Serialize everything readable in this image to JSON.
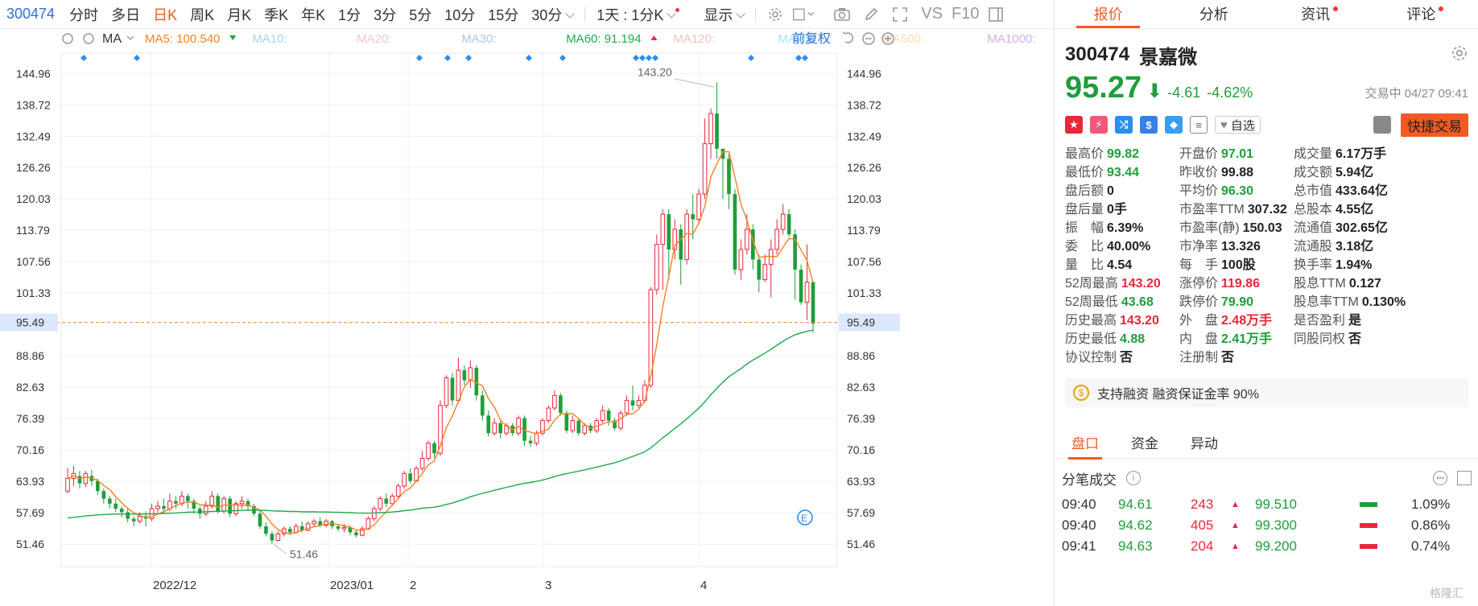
{
  "toolbar": {
    "code": "300474",
    "periods": [
      "分时",
      "多日",
      "日K",
      "周K",
      "月K",
      "季K",
      "年K",
      "1分",
      "3分",
      "5分",
      "10分",
      "15分"
    ],
    "active_period": "日K",
    "period_select": "30分",
    "day_select": "1天 : 1分K",
    "display_select": "显示",
    "vs_label": "VS",
    "f10_label": "F10"
  },
  "indicators": {
    "type_select": "MA",
    "items": [
      {
        "label": "MA5:",
        "value": "100.540",
        "color": "#f58220",
        "arrow": "down"
      },
      {
        "label": "MA10:",
        "value": "",
        "color": "#a8d4f0",
        "arrow": ""
      },
      {
        "label": "MA20:",
        "value": "",
        "color": "#f5c2d8",
        "arrow": ""
      },
      {
        "label": "MA30:",
        "value": "",
        "color": "#a8c8f0",
        "arrow": ""
      },
      {
        "label": "MA60:",
        "value": "91.194",
        "color": "#1aab4c",
        "arrow": "up"
      },
      {
        "label": "MA120:",
        "value": "",
        "color": "#f5c2c2",
        "arrow": ""
      },
      {
        "label": "MA250:",
        "value": "",
        "color": "#a8e4f5",
        "arrow": ""
      },
      {
        "label": "MA500:",
        "value": "",
        "color": "#f5deb0",
        "arrow": ""
      },
      {
        "label": "MA1000:",
        "value": "",
        "color": "#d0b0e8",
        "arrow": ""
      }
    ],
    "adjust_label": "前复权"
  },
  "chart_data": {
    "type": "candlestick",
    "y_ticks": [
      "144.96",
      "138.72",
      "132.49",
      "126.26",
      "120.03",
      "113.79",
      "107.56",
      "101.33",
      "95.49",
      "88.86",
      "82.63",
      "76.39",
      "70.16",
      "63.93",
      "57.69",
      "51.46"
    ],
    "ylim": [
      47.0,
      149.0
    ],
    "x_labels": [
      "2022/12",
      "2023/01",
      "2",
      "3",
      "4"
    ],
    "current_price_label": "95.49",
    "high_annotation": "143.20",
    "low_annotation": "51.46",
    "candles": [
      [
        62.0,
        64.5,
        61.5,
        66.5
      ],
      [
        64.5,
        65.5,
        63.0,
        67.0
      ],
      [
        65.0,
        63.5,
        62.5,
        66.0
      ],
      [
        63.5,
        65.5,
        62.8,
        66.0
      ],
      [
        65.0,
        64.0,
        63.0,
        66.2
      ],
      [
        64.0,
        62.0,
        61.2,
        64.5
      ],
      [
        62.0,
        60.5,
        59.5,
        62.5
      ],
      [
        60.5,
        59.5,
        58.5,
        61.0
      ],
      [
        59.5,
        58.5,
        57.8,
        60.5
      ],
      [
        58.5,
        57.8,
        56.8,
        59.0
      ],
      [
        57.8,
        56.5,
        55.8,
        58.5
      ],
      [
        56.5,
        56.0,
        55.0,
        57.0
      ],
      [
        56.0,
        57.0,
        55.5,
        57.8
      ],
      [
        57.0,
        56.5,
        55.0,
        58.0
      ],
      [
        56.5,
        58.5,
        56.0,
        59.5
      ],
      [
        58.5,
        59.0,
        57.8,
        60.0
      ],
      [
        59.0,
        58.5,
        57.5,
        60.5
      ],
      [
        58.5,
        60.0,
        58.0,
        61.5
      ],
      [
        60.0,
        59.5,
        58.5,
        61.0
      ],
      [
        59.5,
        61.0,
        59.0,
        62.0
      ],
      [
        61.0,
        60.0,
        58.5,
        61.5
      ],
      [
        60.0,
        58.5,
        57.5,
        60.5
      ],
      [
        58.5,
        57.5,
        56.5,
        59.0
      ],
      [
        57.5,
        59.0,
        57.0,
        60.0
      ],
      [
        59.0,
        61.0,
        58.5,
        62.0
      ],
      [
        61.0,
        58.0,
        57.5,
        61.5
      ],
      [
        58.0,
        60.5,
        57.5,
        61.0
      ],
      [
        60.5,
        57.5,
        56.8,
        61.0
      ],
      [
        57.5,
        59.5,
        57.0,
        60.0
      ],
      [
        59.5,
        60.0,
        58.5,
        61.0
      ],
      [
        60.0,
        59.0,
        58.0,
        60.5
      ],
      [
        59.0,
        57.5,
        57.0,
        59.5
      ],
      [
        57.5,
        55.0,
        54.5,
        58.0
      ],
      [
        55.0,
        53.5,
        53.0,
        55.8
      ],
      [
        53.5,
        52.2,
        51.46,
        54.0
      ],
      [
        52.2,
        53.5,
        52.0,
        54.0
      ],
      [
        53.5,
        54.5,
        53.0,
        55.0
      ],
      [
        54.5,
        53.8,
        53.2,
        55.0
      ],
      [
        53.8,
        55.0,
        53.5,
        55.5
      ],
      [
        55.0,
        54.2,
        53.8,
        56.0
      ],
      [
        54.2,
        55.5,
        54.0,
        56.0
      ],
      [
        55.5,
        56.0,
        55.0,
        56.5
      ],
      [
        56.0,
        55.2,
        54.8,
        56.8
      ],
      [
        55.2,
        56.0,
        54.8,
        56.5
      ],
      [
        56.0,
        55.0,
        54.5,
        56.3
      ],
      [
        55.0,
        54.5,
        54.0,
        55.5
      ],
      [
        54.5,
        54.8,
        53.8,
        55.5
      ],
      [
        54.8,
        53.8,
        53.2,
        55.2
      ],
      [
        53.8,
        53.2,
        52.8,
        54.2
      ],
      [
        53.2,
        54.5,
        53.0,
        55.0
      ],
      [
        54.5,
        56.5,
        54.3,
        57.0
      ],
      [
        56.5,
        58.5,
        56.0,
        59.0
      ],
      [
        58.5,
        60.5,
        58.0,
        61.0
      ],
      [
        60.5,
        59.5,
        58.8,
        61.5
      ],
      [
        59.5,
        61.0,
        59.0,
        61.5
      ],
      [
        61.0,
        63.0,
        60.5,
        63.5
      ],
      [
        63.0,
        65.5,
        62.5,
        66.0
      ],
      [
        65.5,
        64.0,
        63.5,
        66.5
      ],
      [
        64.0,
        66.5,
        63.8,
        67.0
      ],
      [
        66.5,
        68.5,
        66.0,
        70.0
      ],
      [
        68.5,
        71.5,
        68.0,
        72.0
      ],
      [
        71.5,
        69.5,
        68.5,
        72.0
      ],
      [
        69.5,
        79.0,
        69.0,
        80.0
      ],
      [
        79.0,
        84.5,
        78.5,
        85.0
      ],
      [
        84.5,
        80.0,
        79.0,
        85.5
      ],
      [
        80.0,
        86.0,
        79.5,
        88.5
      ],
      [
        86.0,
        84.0,
        83.0,
        87.0
      ],
      [
        84.0,
        86.5,
        82.5,
        88.0
      ],
      [
        86.5,
        81.0,
        80.0,
        87.0
      ],
      [
        81.0,
        77.0,
        76.0,
        82.0
      ],
      [
        77.0,
        73.5,
        72.8,
        78.0
      ],
      [
        73.5,
        75.5,
        73.0,
        76.5
      ],
      [
        75.5,
        73.5,
        72.5,
        76.0
      ],
      [
        73.5,
        75.0,
        73.0,
        75.5
      ],
      [
        75.0,
        73.5,
        73.0,
        75.5
      ],
      [
        73.5,
        76.5,
        73.0,
        77.0
      ],
      [
        76.5,
        72.0,
        71.0,
        77.0
      ],
      [
        72.0,
        71.5,
        70.8,
        73.0
      ],
      [
        71.5,
        73.5,
        71.0,
        74.0
      ],
      [
        73.5,
        76.0,
        73.0,
        76.5
      ],
      [
        76.0,
        78.5,
        75.5,
        79.0
      ],
      [
        78.5,
        81.0,
        78.0,
        82.0
      ],
      [
        81.0,
        77.5,
        77.0,
        81.5
      ],
      [
        77.5,
        74.0,
        73.5,
        78.0
      ],
      [
        74.0,
        76.0,
        73.5,
        77.0
      ],
      [
        76.0,
        73.5,
        73.0,
        76.5
      ],
      [
        73.5,
        75.0,
        73.0,
        75.5
      ],
      [
        75.0,
        74.0,
        73.5,
        75.5
      ],
      [
        74.0,
        76.0,
        73.5,
        76.5
      ],
      [
        76.0,
        78.0,
        75.5,
        79.0
      ],
      [
        78.0,
        76.0,
        75.0,
        78.5
      ],
      [
        76.0,
        74.5,
        74.0,
        76.5
      ],
      [
        74.5,
        77.5,
        74.0,
        78.0
      ],
      [
        77.5,
        80.0,
        77.0,
        81.0
      ],
      [
        80.0,
        79.0,
        78.0,
        83.0
      ],
      [
        79.0,
        80.0,
        78.5,
        81.0
      ],
      [
        80.0,
        83.0,
        79.5,
        84.0
      ],
      [
        83.0,
        102.0,
        82.5,
        102.5
      ],
      [
        102.0,
        111.0,
        101.0,
        113.0
      ],
      [
        111.0,
        117.0,
        102.0,
        118.0
      ],
      [
        117.0,
        110.0,
        104.0,
        118.0
      ],
      [
        110.0,
        114.0,
        108.0,
        116.0
      ],
      [
        114.0,
        108.0,
        103.0,
        115.0
      ],
      [
        108.0,
        117.0,
        107.0,
        118.0
      ],
      [
        117.0,
        116.0,
        112.0,
        121.0
      ],
      [
        116.0,
        121.0,
        115.0,
        122.0
      ],
      [
        121.0,
        131.0,
        120.0,
        136.0
      ],
      [
        131.0,
        137.0,
        128.0,
        138.0
      ],
      [
        137.0,
        130.0,
        128.0,
        143.2
      ],
      [
        130.0,
        128.0,
        120.0,
        130.0
      ],
      [
        128.0,
        121.0,
        118.0,
        129.0
      ],
      [
        121.0,
        106.0,
        105.0,
        122.0
      ],
      [
        106.0,
        110.0,
        104.0,
        112.0
      ],
      [
        110.0,
        114.0,
        109.0,
        117.0
      ],
      [
        114.0,
        108.0,
        106.0,
        115.0
      ],
      [
        108.0,
        104.0,
        101.5,
        109.0
      ],
      [
        104.0,
        107.0,
        103.5,
        109.0
      ],
      [
        107.0,
        110.0,
        100.5,
        112.0
      ],
      [
        110.0,
        114.0,
        109.0,
        116.0
      ],
      [
        114.0,
        117.0,
        113.0,
        119.0
      ],
      [
        117.0,
        113.0,
        112.5,
        118.0
      ],
      [
        113.0,
        106.0,
        100.0,
        114.0
      ],
      [
        106.0,
        99.5,
        99.0,
        107.0
      ],
      [
        99.5,
        103.5,
        96.0,
        111.0
      ],
      [
        103.5,
        95.27,
        93.44,
        99.82
      ]
    ]
  },
  "quote": {
    "tabs": [
      "报价",
      "分析",
      "资讯",
      "评论"
    ],
    "active_tab": "报价",
    "code": "300474",
    "name": "景嘉微",
    "price": "95.27",
    "change": "-4.61",
    "change_pct": "-4.62%",
    "status": "交易中 04/27 09:41",
    "watch_label": "自选",
    "trade_label": "快捷交易",
    "stats": [
      {
        "k": "最高价",
        "v": "99.82",
        "c": "dn"
      },
      {
        "k": "开盘价",
        "v": "97.01",
        "c": "dn"
      },
      {
        "k": "成交量",
        "v": "6.17万手",
        "c": ""
      },
      {
        "k": "最低价",
        "v": "93.44",
        "c": "dn"
      },
      {
        "k": "昨收价",
        "v": "99.88",
        "c": ""
      },
      {
        "k": "成交额",
        "v": "5.94亿",
        "c": ""
      },
      {
        "k": "盘后额",
        "v": "0",
        "c": ""
      },
      {
        "k": "平均价",
        "v": "96.30",
        "c": "dn"
      },
      {
        "k": "总市值",
        "v": "433.64亿",
        "c": ""
      },
      {
        "k": "盘后量",
        "v": "0手",
        "c": ""
      },
      {
        "k": "市盈率TTM",
        "v": "307.32",
        "c": ""
      },
      {
        "k": "总股本",
        "v": "4.55亿",
        "c": ""
      },
      {
        "k": "振　幅",
        "v": "6.39%",
        "c": ""
      },
      {
        "k": "市盈率(静)",
        "v": "150.03",
        "c": ""
      },
      {
        "k": "流通值",
        "v": "302.65亿",
        "c": ""
      },
      {
        "k": "委　比",
        "v": "40.00%",
        "c": ""
      },
      {
        "k": "市净率",
        "v": "13.326",
        "c": ""
      },
      {
        "k": "流通股",
        "v": "3.18亿",
        "c": ""
      },
      {
        "k": "量　比",
        "v": "4.54",
        "c": ""
      },
      {
        "k": "每　手",
        "v": "100股",
        "c": ""
      },
      {
        "k": "换手率",
        "v": "1.94%",
        "c": ""
      },
      {
        "k": "52周最高",
        "v": "143.20",
        "c": "up"
      },
      {
        "k": "涨停价",
        "v": "119.86",
        "c": "up"
      },
      {
        "k": "股息TTM",
        "v": "0.127",
        "c": ""
      },
      {
        "k": "52周最低",
        "v": "43.68",
        "c": "dn"
      },
      {
        "k": "跌停价",
        "v": "79.90",
        "c": "dn"
      },
      {
        "k": "股息率TTM",
        "v": "0.130%",
        "c": ""
      },
      {
        "k": "历史最高",
        "v": "143.20",
        "c": "up"
      },
      {
        "k": "外　盘",
        "v": "2.48万手",
        "c": "up"
      },
      {
        "k": "是否盈利",
        "v": "是",
        "c": ""
      },
      {
        "k": "历史最低",
        "v": "4.88",
        "c": "dn"
      },
      {
        "k": "内　盘",
        "v": "2.41万手",
        "c": "dn"
      },
      {
        "k": "同股同权",
        "v": "否",
        "c": ""
      },
      {
        "k": "协议控制",
        "v": "否",
        "c": ""
      },
      {
        "k": "注册制",
        "v": "否",
        "c": ""
      }
    ],
    "margin_text": "支持融资 融资保证金率 90%",
    "subtabs": [
      "盘口",
      "资金",
      "异动"
    ],
    "active_subtab": "盘口",
    "ticks_title": "分笔成交",
    "ticks": [
      {
        "time": "09:40",
        "price": "94.61",
        "vol": "243",
        "amount": "99.510",
        "bar": "green",
        "pct": "1.09%"
      },
      {
        "time": "09:40",
        "price": "94.62",
        "vol": "405",
        "amount": "99.300",
        "bar": "red",
        "pct": "0.86%"
      },
      {
        "time": "09:41",
        "price": "94.63",
        "vol": "204",
        "amount": "99.200",
        "bar": "red",
        "pct": "0.74%"
      }
    ],
    "watermark": "格隆汇"
  },
  "colors": {
    "up": "#e8273a",
    "down": "#1f9e3a",
    "accent": "#f15a22",
    "ma5": "#f58220",
    "ma60": "#1aab4c"
  }
}
